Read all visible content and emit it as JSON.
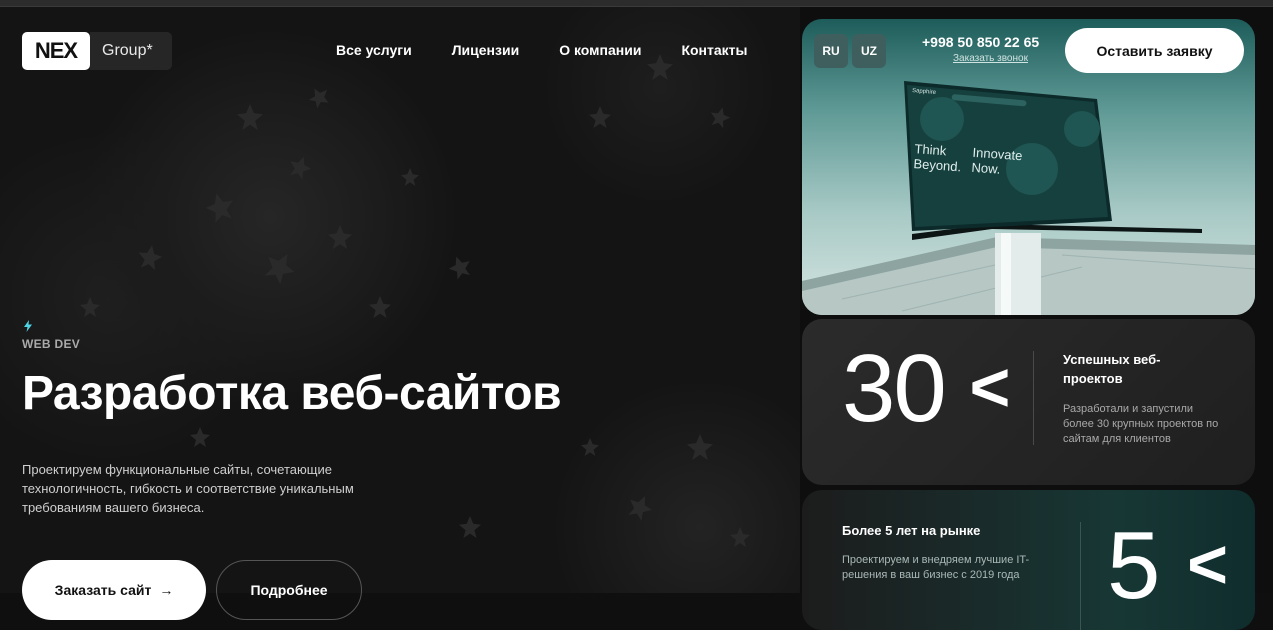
{
  "brand": {
    "logo_text": "NEX",
    "group_label": "Group*"
  },
  "nav": [
    {
      "label": "Все услуги"
    },
    {
      "label": "Лицензии"
    },
    {
      "label": "О компании"
    },
    {
      "label": "Контакты"
    }
  ],
  "hero": {
    "eyebrow": "WEB DEV",
    "title": "Разработка веб-сайтов",
    "description": "Проектируем функциональные сайты, сочетающие технологичность, гибкость и соответствие уникальным требованиям вашего бизнеса.",
    "primary_button": "Заказать сайт",
    "primary_arrow": "→",
    "secondary_button": "Подробнее"
  },
  "header_right": {
    "languages": [
      "RU",
      "UZ"
    ],
    "phone": "+998 50 850 22 65",
    "callback_link": "Заказать звонок",
    "request_button": "Оставить заявку"
  },
  "laptop_screen": {
    "brand": "Sapphire",
    "line1": "Think Beyond.",
    "line2": "Innovate Now."
  },
  "stats": [
    {
      "value": "30",
      "chevron": "<",
      "title": "Успешных веб-проектов",
      "text": "Разработали и запустили более 30 крупных проектов по сайтам для клиентов"
    },
    {
      "value": "5",
      "chevron": "<",
      "title": "Более 5 лет на рынке",
      "text": "Проектируем и внедряем лучшие IT-решения в ваш бизнес с 2019 года"
    }
  ],
  "colors": {
    "accent_bolt": "#4fd4e6",
    "teal_dark": "#1d5c5a",
    "white": "#ffffff"
  },
  "icons": {
    "bolt": "lightning-bolt-icon",
    "arrow": "arrow-right-icon"
  }
}
